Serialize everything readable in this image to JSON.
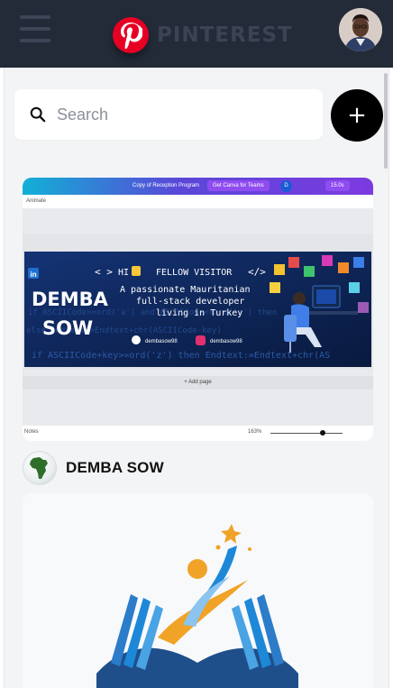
{
  "header": {
    "brand": "PINTEREST",
    "menu_icon": "hamburger-icon",
    "logo_icon": "pinterest-logo-icon",
    "avatar_icon": "user-avatar",
    "colors": {
      "bar": "#232b38",
      "brand_red": "#e60023",
      "brand_text": "#3b4453"
    }
  },
  "search": {
    "placeholder": "Search",
    "value": "",
    "icon": "search-icon"
  },
  "add_button": {
    "label": "+",
    "icon": "plus-icon"
  },
  "pins": [
    {
      "canva": {
        "title": "Copy of Reception Program",
        "cta": "Get Canva for Teams",
        "user_initial": "D",
        "share": "15.0s",
        "subtitle": "Animate",
        "add_page": "+ Add page",
        "footer_left": "Notes",
        "zoom": "163%"
      },
      "banner": {
        "greeting": "HI",
        "greeting2": "FELLOW VISITOR",
        "tagline1": "A passionate Mauritanian",
        "tagline2": "full-stack developer",
        "tagline3": "living in Turkey",
        "name1": "DEMBA",
        "name2": "SOW",
        "github": "dembasow98",
        "instagram": "dembasow98",
        "code_bg1": "if ASCIICode>=ord('a') and ASCIICode<=ord('z') then",
        "code_bg2": "else Endtext:=Endtext+chr(ASCIICode-key)",
        "code_bg3": "if ASCIICode+key>=ord('z') then Endtext:=Endtext+chr(AS"
      },
      "author": {
        "name": "DEMBA SOW",
        "avatar_icon": "africa-map-icon"
      }
    },
    {
      "image": "education-book-logo"
    }
  ]
}
